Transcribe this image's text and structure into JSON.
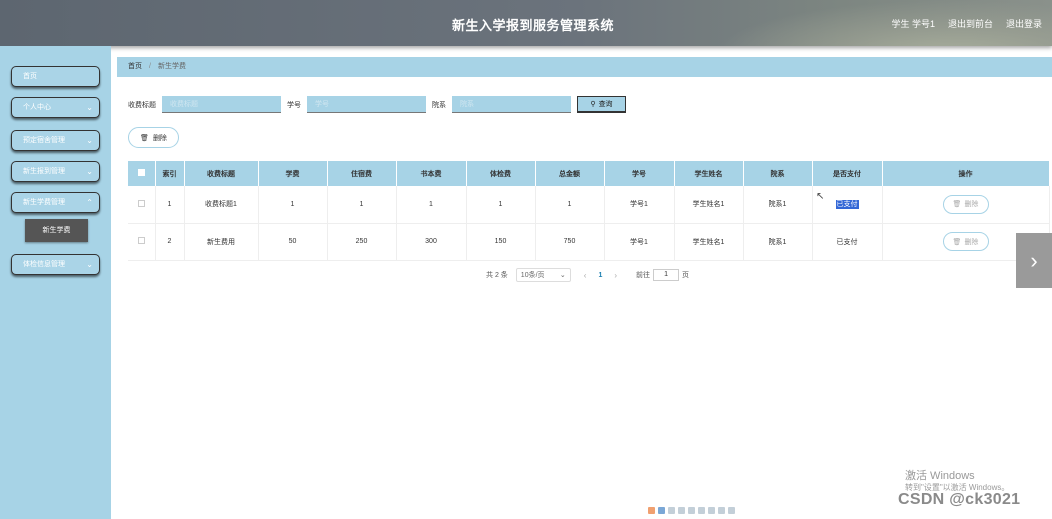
{
  "header": {
    "title": "新生入学报到服务管理系统",
    "user": "学生 学号1",
    "back_link": "退出到前台",
    "logout": "退出登录"
  },
  "sidebar": {
    "items": [
      {
        "label": "首页",
        "has_chevron": false
      },
      {
        "label": "个人中心",
        "has_chevron": true
      },
      {
        "label": "预定宿舍管理",
        "has_chevron": true
      },
      {
        "label": "新生报到管理",
        "has_chevron": true
      },
      {
        "label": "新生学费管理",
        "has_chevron": true
      },
      {
        "label": "体检信息管理",
        "has_chevron": true
      }
    ],
    "active_sub": "新生学费"
  },
  "breadcrumb": {
    "home": "首页",
    "current": "新生学费"
  },
  "search": {
    "fields": [
      {
        "label": "收费标题",
        "placeholder": "收费标题"
      },
      {
        "label": "学号",
        "placeholder": "学号"
      },
      {
        "label": "院系",
        "placeholder": "院系"
      }
    ],
    "query_button": "查询"
  },
  "toolbar": {
    "delete_button": "删除"
  },
  "table": {
    "columns": [
      "索引",
      "收费标题",
      "学费",
      "住宿费",
      "书本费",
      "体检费",
      "总金额",
      "学号",
      "学生姓名",
      "院系",
      "是否支付",
      "操作"
    ],
    "rows": [
      {
        "index": "1",
        "title": "收费标题1",
        "tuition": "1",
        "lodging": "1",
        "books": "1",
        "medical": "1",
        "total": "1",
        "student_no": "学号1",
        "name": "学生姓名1",
        "dept": "院系1",
        "paid": "已支付",
        "action": "删除"
      },
      {
        "index": "2",
        "title": "新生费用",
        "tuition": "50",
        "lodging": "250",
        "books": "300",
        "medical": "150",
        "total": "750",
        "student_no": "学号1",
        "name": "学生姓名1",
        "dept": "院系1",
        "paid": "已支付",
        "action": "删除"
      }
    ]
  },
  "pagination": {
    "total": "共 2 条",
    "page_size": "10条/页",
    "current_page": "1",
    "goto_label": "前往",
    "goto_value": "1",
    "goto_unit": "页"
  },
  "overlay": {
    "activation_title": "激活 Windows",
    "activation_sub": "转到\"设置\"以激活 Windows。",
    "watermark": "CSDN @ck3021"
  },
  "colors": {
    "accent": "#a7d3e6",
    "header": "#6b737c",
    "active_sub": "#555555",
    "selection": "#3367d6"
  }
}
